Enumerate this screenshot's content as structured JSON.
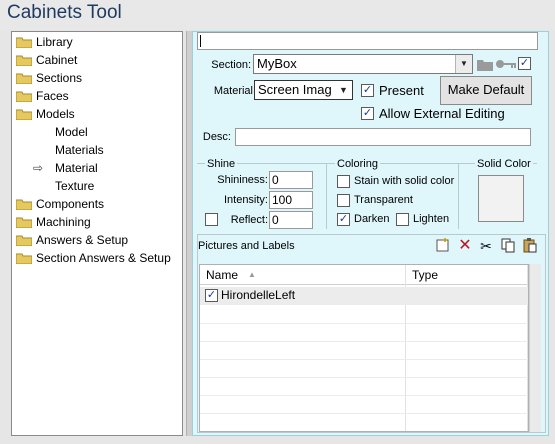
{
  "window": {
    "title": "Cabinets Tool"
  },
  "tree": {
    "items": [
      {
        "label": "Library",
        "icon": "folder-icon"
      },
      {
        "label": "Cabinet",
        "icon": "folder-icon"
      },
      {
        "label": "Sections",
        "icon": "folder-icon"
      },
      {
        "label": "Faces",
        "icon": "folder-icon"
      },
      {
        "label": "Models",
        "icon": "folder-icon"
      },
      {
        "label": "Model",
        "icon": ""
      },
      {
        "label": "Materials",
        "icon": ""
      },
      {
        "label": "Material",
        "icon": "arrow-right-icon"
      },
      {
        "label": "Texture",
        "icon": ""
      },
      {
        "label": "Components",
        "icon": "folder-icon"
      },
      {
        "label": "Machining",
        "icon": "folder-icon"
      },
      {
        "label": "Answers & Setup",
        "icon": "folder-icon"
      },
      {
        "label": "Section Answers & Setup",
        "icon": "folder-icon"
      }
    ],
    "folder_color": "#e6c860"
  },
  "form": {
    "top_value": "",
    "section_label": "Section:",
    "section_value": "MyBox",
    "material_label": "Material",
    "material_value": "Screen Imag",
    "present_label": "Present",
    "present_checked": true,
    "allow_external_label": "Allow External Editing",
    "allow_external_checked": true,
    "make_default_label": "Make Default",
    "desc_label": "Desc:",
    "desc_value": "",
    "section_lock_checked": true
  },
  "shine": {
    "title": "Shine",
    "shininess_label": "Shininess:",
    "shininess_value": "0",
    "intensity_label": "Intensity:",
    "intensity_value": "100",
    "reflect_label": "Reflect:",
    "reflect_value": "0",
    "reflect_checked": false
  },
  "coloring": {
    "title": "Coloring",
    "stain_label": "Stain with solid color",
    "stain_checked": false,
    "transparent_label": "Transparent",
    "transparent_checked": false,
    "darken_label": "Darken",
    "darken_checked": true,
    "lighten_label": "Lighten",
    "lighten_checked": false
  },
  "solid_color": {
    "title": "Solid Color",
    "color": "#f2f2f2"
  },
  "pictures": {
    "title": "Pictures and Labels",
    "columns": [
      "Name",
      "Type"
    ],
    "rows": [
      {
        "name": "HirondelleLeft",
        "type": "",
        "checked": true
      }
    ]
  },
  "colors": {
    "panel_bg": "#dff6fb",
    "title_text": "#1f3a5f"
  }
}
